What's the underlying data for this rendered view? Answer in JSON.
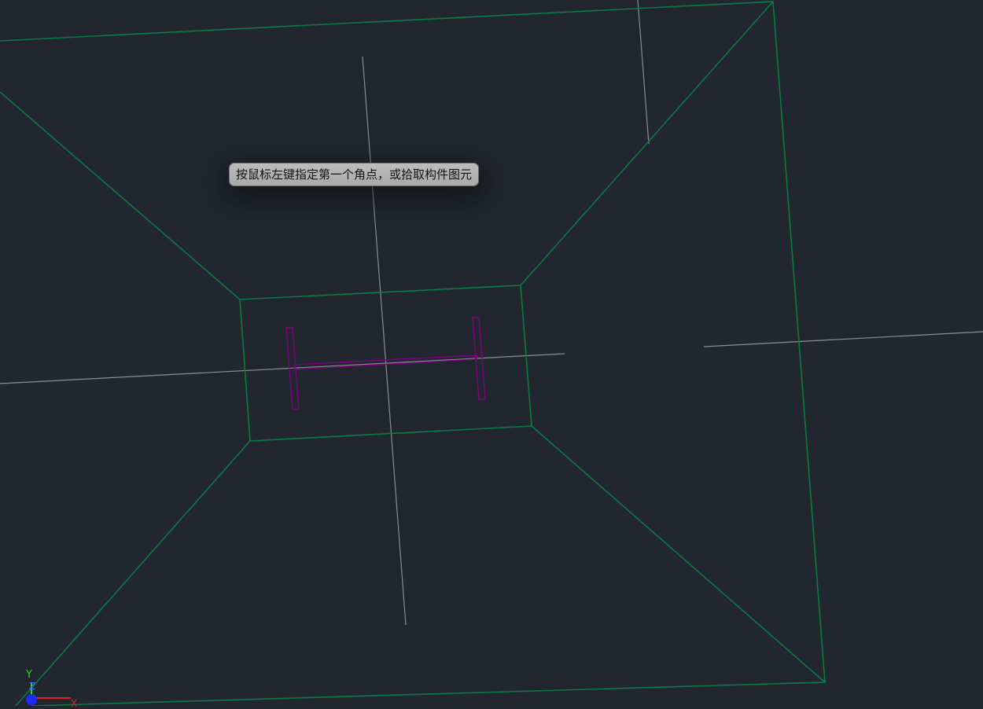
{
  "viewport": {
    "background_color": "#22272f"
  },
  "colors": {
    "pit_outline": "#0a7a44",
    "beam_outline": "#800080",
    "axis_lines": "#8a8e94",
    "tooltip_background": "#b0b0b0"
  },
  "prompt": {
    "text": "按鼠标左键指定第一个角点，或拾取构件图元"
  },
  "ucs": {
    "y_label": "Y",
    "z_label": "Z",
    "x_label": "X"
  }
}
